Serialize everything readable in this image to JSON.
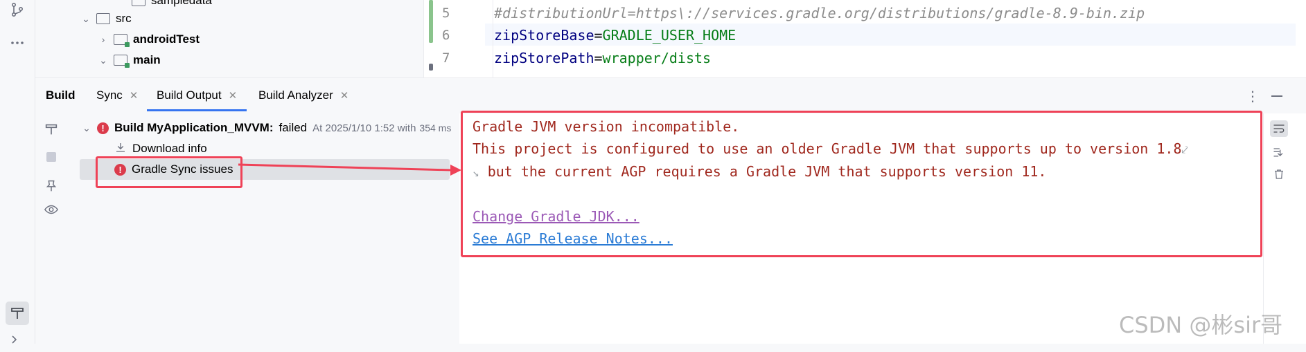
{
  "project_tree": {
    "items": [
      {
        "label": "sampledata",
        "depth": 2,
        "chevron": "",
        "bold": false
      },
      {
        "label": "src",
        "depth": 1,
        "chevron": "down",
        "bold": false
      },
      {
        "label": "androidTest",
        "depth": 2,
        "chevron": "right",
        "bold": true
      },
      {
        "label": "main",
        "depth": 2,
        "chevron": "down",
        "bold": true
      }
    ]
  },
  "editor": {
    "lines": [
      {
        "no": "5",
        "text": "#distributionUrl=https\\://services.gradle.org/distributions/gradle-8.9-bin.zip"
      },
      {
        "no": "6",
        "key": "zipStoreBase",
        "value": "GRADLE_USER_HOME"
      },
      {
        "no": "7",
        "key": "zipStorePath",
        "value": "wrapper/dists"
      }
    ]
  },
  "tool_window": {
    "title": "Build",
    "tabs": [
      {
        "label": "Sync",
        "closable": true
      },
      {
        "label": "Build Output",
        "closable": true,
        "active": true
      },
      {
        "label": "Build Analyzer",
        "closable": true
      }
    ],
    "more_icon": "more-vertical-icon",
    "minimize_icon": "minimize-icon"
  },
  "build_tree": {
    "root": {
      "name": "Build MyApplication_MVVM:",
      "status": "failed",
      "meta": "At 2025/1/10 1:52 with",
      "duration": "354 ms"
    },
    "children": [
      {
        "label": "Download info",
        "icon": "download-icon"
      },
      {
        "label": "Gradle Sync issues",
        "icon": "error-icon",
        "selected": true
      }
    ]
  },
  "output": {
    "lines": [
      "Gradle JVM version incompatible.",
      "This project is configured to use an older Gradle JVM that supports up to version 1.8",
      "but the current AGP requires a Gradle JVM that supports version 11."
    ],
    "links": [
      {
        "label": "Change Gradle JDK...",
        "color": "#9b59b6"
      },
      {
        "label": "See AGP Release Notes...",
        "color": "#2a7bd5"
      }
    ]
  },
  "watermark": "CSDN @彬sir哥",
  "colors": {
    "accent": "#3574f0",
    "error": "#db3b4b",
    "annotation": "#ef4257",
    "error_text": "#a0281e"
  }
}
